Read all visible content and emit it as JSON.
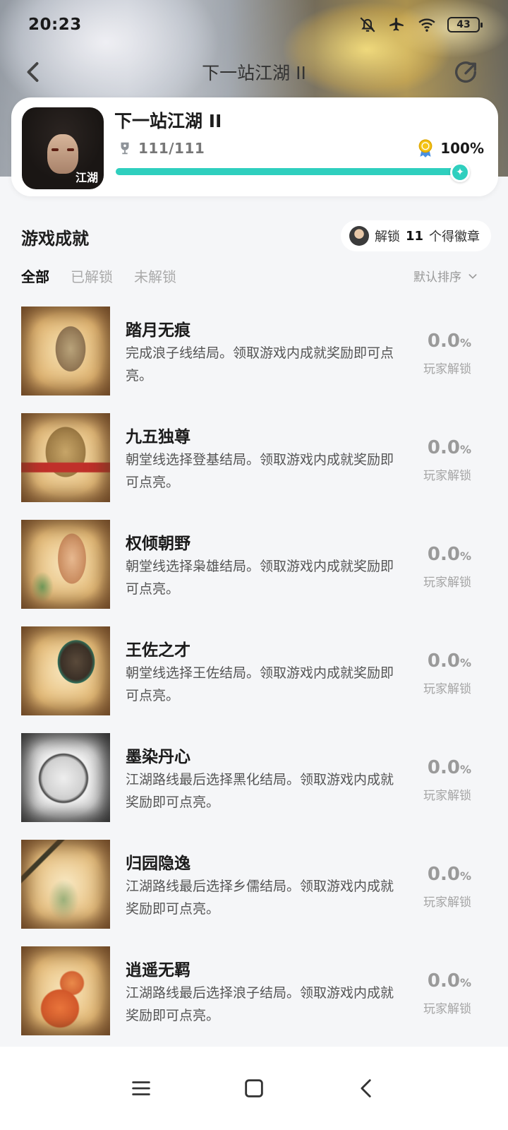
{
  "status_bar": {
    "time": "20:23",
    "battery": "43"
  },
  "nav": {
    "title": "下一站江湖 II"
  },
  "game": {
    "name": "下一站江湖 II",
    "trophy_count": "111/111",
    "percent_text": "100%",
    "progress": 1.0,
    "cover_text": "江湖"
  },
  "section": {
    "title": "游戏成就",
    "badge_prefix": "解锁",
    "badge_count": "11",
    "badge_suffix": "个得徽章"
  },
  "tabs": [
    {
      "label": "全部"
    },
    {
      "label": "已解锁"
    },
    {
      "label": "未解锁"
    }
  ],
  "sort_label": "默认排序",
  "achievements": [
    {
      "title": "踏月无痕",
      "desc": "完成浪子线结局。领取游戏内成就奖励即可点亮。",
      "rate": "0.0",
      "rate_unit": "%",
      "rate_label": "玩家解锁",
      "icon": "boot-icon"
    },
    {
      "title": "九五独尊",
      "desc": "朝堂线选择登基结局。领取游戏内成就奖励即可点亮。",
      "rate": "0.0",
      "rate_unit": "%",
      "rate_label": "玩家解锁",
      "icon": "throne-icon"
    },
    {
      "title": "权倾朝野",
      "desc": "朝堂线选择枭雄结局。领取游戏内成就奖励即可点亮。",
      "rate": "0.0",
      "rate_unit": "%",
      "rate_label": "玩家解锁",
      "icon": "hand-icon"
    },
    {
      "title": "王佐之才",
      "desc": "朝堂线选择王佐结局。领取游戏内成就奖励即可点亮。",
      "rate": "0.0",
      "rate_unit": "%",
      "rate_label": "玩家解锁",
      "icon": "inkstone-brush-icon"
    },
    {
      "title": "墨染丹心",
      "desc": "江湖路线最后选择黑化结局。领取游戏内成就奖励即可点亮。",
      "rate": "0.0",
      "rate_unit": "%",
      "rate_label": "玩家解锁",
      "icon": "ink-moon-icon"
    },
    {
      "title": "归园隐逸",
      "desc": "江湖路线最后选择乡儒结局。领取游戏内成就奖励即可点亮。",
      "rate": "0.0",
      "rate_unit": "%",
      "rate_label": "玩家解锁",
      "icon": "bamboo-icon"
    },
    {
      "title": "逍遥无羁",
      "desc": "江湖路线最后选择浪子结局。领取游戏内成就奖励即可点亮。",
      "rate": "0.0",
      "rate_unit": "%",
      "rate_label": "玩家解锁",
      "icon": "gourd-icon"
    }
  ]
}
